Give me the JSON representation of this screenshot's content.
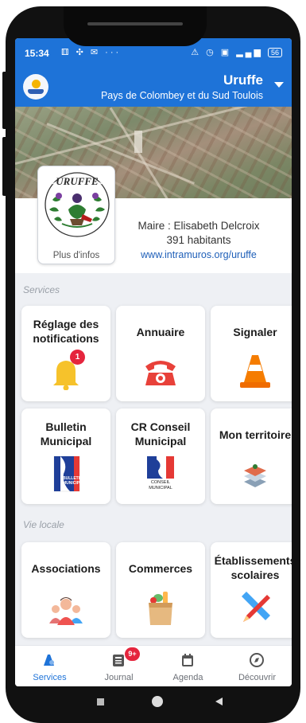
{
  "status_bar": {
    "time": "15:34",
    "left_icons": "⚅ ✣ ✉ ···",
    "right_icons": "⚠ ◷ ▣ ▂▄▆",
    "battery": "56"
  },
  "header": {
    "town": "Uruffe",
    "community": "Pays de Colombey et du Sud Toulois"
  },
  "crest": {
    "motto": "URUFFE",
    "more_info": "Plus d'infos"
  },
  "town_info": {
    "mayor": "Maire : Elisabeth Delcroix",
    "inhabitants": "391 habitants",
    "website": "www.intramuros.org/uruffe"
  },
  "sections": {
    "services": "Services",
    "local_life": "Vie locale"
  },
  "tiles": [
    {
      "title": "Réglage des notifications",
      "icon": "bell-icon",
      "badge": "1"
    },
    {
      "title": "Annuaire",
      "icon": "telephone-icon"
    },
    {
      "title": "Signaler",
      "icon": "traffic-cone-icon"
    },
    {
      "title": "Bulletin Municipal",
      "icon": "bulletin-icon",
      "icon_text": "BULLETIN MUNICIPAL"
    },
    {
      "title": "CR Conseil Municipal",
      "icon": "conseil-icon",
      "icon_text": "CONSEIL MUNICIPAL"
    },
    {
      "title": "Mon territoire",
      "icon": "map-layers-icon"
    },
    {
      "title": "Associations",
      "icon": "people-icon"
    },
    {
      "title": "Commerces",
      "icon": "grocery-bag-icon"
    },
    {
      "title": "Établissements scolaires",
      "icon": "pencil-ruler-icon"
    }
  ],
  "bottom_nav": [
    {
      "label": "Services",
      "icon": "services-icon",
      "active": true
    },
    {
      "label": "Journal",
      "icon": "newspaper-icon",
      "badge": "9+"
    },
    {
      "label": "Agenda",
      "icon": "calendar-icon"
    },
    {
      "label": "Découvrir",
      "icon": "compass-icon"
    }
  ],
  "colors": {
    "primary": "#1e73d8",
    "badge": "#e5253d"
  }
}
